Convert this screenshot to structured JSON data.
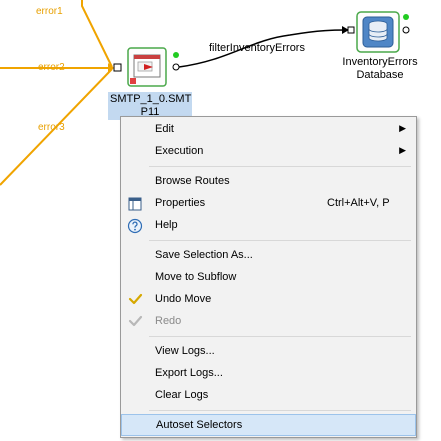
{
  "diagram": {
    "wires": [
      {
        "label": "error1"
      },
      {
        "label": "error2"
      },
      {
        "label": "error3"
      }
    ],
    "selected_component": {
      "label_line1": "SMTP_1_0.SMT",
      "label_line2": "P11"
    },
    "flow_label": "filterInventoryErrors",
    "database_component": {
      "label_line1": "InventoryErrors",
      "label_line2": "Database"
    },
    "colors": {
      "wire": "#f0a400",
      "status_dot": "#22cc22",
      "selection": "#c3d9f0"
    }
  },
  "context_menu": {
    "items": [
      {
        "label": "Edit",
        "submenu": true
      },
      {
        "label": "Execution",
        "submenu": true
      },
      {
        "label": "Browse Routes"
      },
      {
        "label": "Properties",
        "icon": "properties-icon",
        "shortcut": "Ctrl+Alt+V, P"
      },
      {
        "label": "Help",
        "icon": "help-icon"
      },
      {
        "label": "Save Selection As..."
      },
      {
        "label": "Move to Subflow"
      },
      {
        "label": "Undo Move",
        "icon": "undo-icon"
      },
      {
        "label": "Redo",
        "icon": "redo-icon",
        "disabled": true
      },
      {
        "label": "View Logs..."
      },
      {
        "label": "Export Logs..."
      },
      {
        "label": "Clear Logs"
      },
      {
        "label": "Autoset Selectors",
        "highlighted": true
      }
    ],
    "submenu_arrow": "▶"
  }
}
